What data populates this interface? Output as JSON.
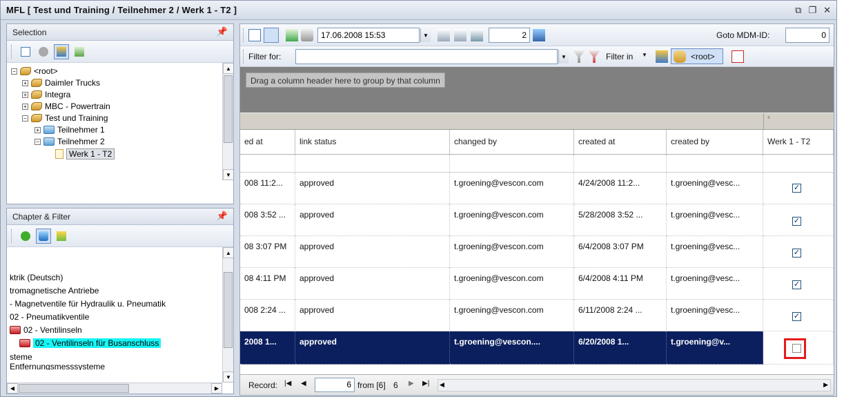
{
  "window": {
    "title": "MFL [ Test und Training / Teilnehmer 2 / Werk 1 - T2 ]",
    "ctrl_restore": "⧉",
    "ctrl_max": "❐",
    "ctrl_close": "✕"
  },
  "selection_panel": {
    "title": "Selection",
    "pin": "📌",
    "tree": [
      {
        "label": "<root>",
        "expander": "−"
      },
      {
        "label": "Daimler Trucks",
        "expander": "+"
      },
      {
        "label": "Integra",
        "expander": "+"
      },
      {
        "label": "MBC - Powertrain",
        "expander": "+"
      },
      {
        "label": "Test und Training",
        "expander": "−"
      },
      {
        "label": "Teilnehmer 1",
        "expander": "+"
      },
      {
        "label": "Teilnehmer 2",
        "expander": "−"
      },
      {
        "label": "Werk 1 - T2",
        "expander": ""
      }
    ]
  },
  "chapter_panel": {
    "title": "Chapter & Filter",
    "pin": "📌",
    "items": [
      {
        "label": "ktrik (Deutsch)"
      },
      {
        "label": "tromagnetische Antriebe"
      },
      {
        "label": "- Magnetventile für Hydraulik u. Pneumatik"
      },
      {
        "label": "02 - Pneumatikventile"
      },
      {
        "label": "02 - Ventilinseln"
      },
      {
        "label": "02 - Ventilinseln für Busanschluss"
      },
      {
        "label": "steme"
      },
      {
        "label": "Entfernungsmesssysteme"
      }
    ]
  },
  "toolbar": {
    "datetime": "17.06.2008 15:53",
    "count": "2",
    "goto_label": "Goto MDM-ID:",
    "goto_value": "0",
    "filter_label": "Filter for:",
    "filter_value": "",
    "filter_in_label": "Filter in",
    "root_label": "<root>",
    "dd_arrow": "▼"
  },
  "grid": {
    "group_hint": "Drag a column header here to group by that column",
    "band_mark": "°",
    "columns": [
      "ed at",
      "link status",
      "changed by",
      "created at",
      "created by",
      "Werk 1 - T2"
    ],
    "rows": [
      {
        "changed_at": "008 11:2...",
        "status": "approved",
        "changed_by": "t.groening@vescon.com",
        "created_at": "4/24/2008 11:2...",
        "created_by": "t.groening@vesc...",
        "werk": "✓",
        "selected": false
      },
      {
        "changed_at": "008 3:52 ...",
        "status": "approved",
        "changed_by": "t.groening@vescon.com",
        "created_at": "5/28/2008 3:52 ...",
        "created_by": "t.groening@vesc...",
        "werk": "✓",
        "selected": false
      },
      {
        "changed_at": "08 3:07 PM",
        "status": "approved",
        "changed_by": "t.groening@vescon.com",
        "created_at": "6/4/2008 3:07 PM",
        "created_by": "t.groening@vesc...",
        "werk": "✓",
        "selected": false
      },
      {
        "changed_at": "08 4:11 PM",
        "status": "approved",
        "changed_by": "t.groening@vescon.com",
        "created_at": "6/4/2008 4:11 PM",
        "created_by": "t.groening@vesc...",
        "werk": "✓",
        "selected": false
      },
      {
        "changed_at": "008 2:24 ...",
        "status": "approved",
        "changed_by": "t.groening@vescon.com",
        "created_at": "6/11/2008 2:24 ...",
        "created_by": "t.groening@vesc...",
        "werk": "✓",
        "selected": false
      },
      {
        "changed_at": "2008 1...",
        "status": "approved",
        "changed_by": "t.groening@vescon....",
        "created_at": "6/20/2008 1...",
        "created_by": "t.groening@v...",
        "werk": "",
        "selected": true
      }
    ]
  },
  "navigator": {
    "label": "Record:",
    "first": "|◀",
    "prev": "◀",
    "current": "6",
    "from": "from [6]",
    "total": "6",
    "next": "▶",
    "last": "▶|",
    "scroll_left": "◀",
    "scroll_right": "▶"
  },
  "scroll_glyphs": {
    "up": "▲",
    "down": "▼",
    "left": "◀",
    "right": "▶"
  },
  "colors": {
    "selected_row": "#0b1f5e",
    "highlight": "#17f5f5",
    "red_outline": "#e41a1a"
  }
}
